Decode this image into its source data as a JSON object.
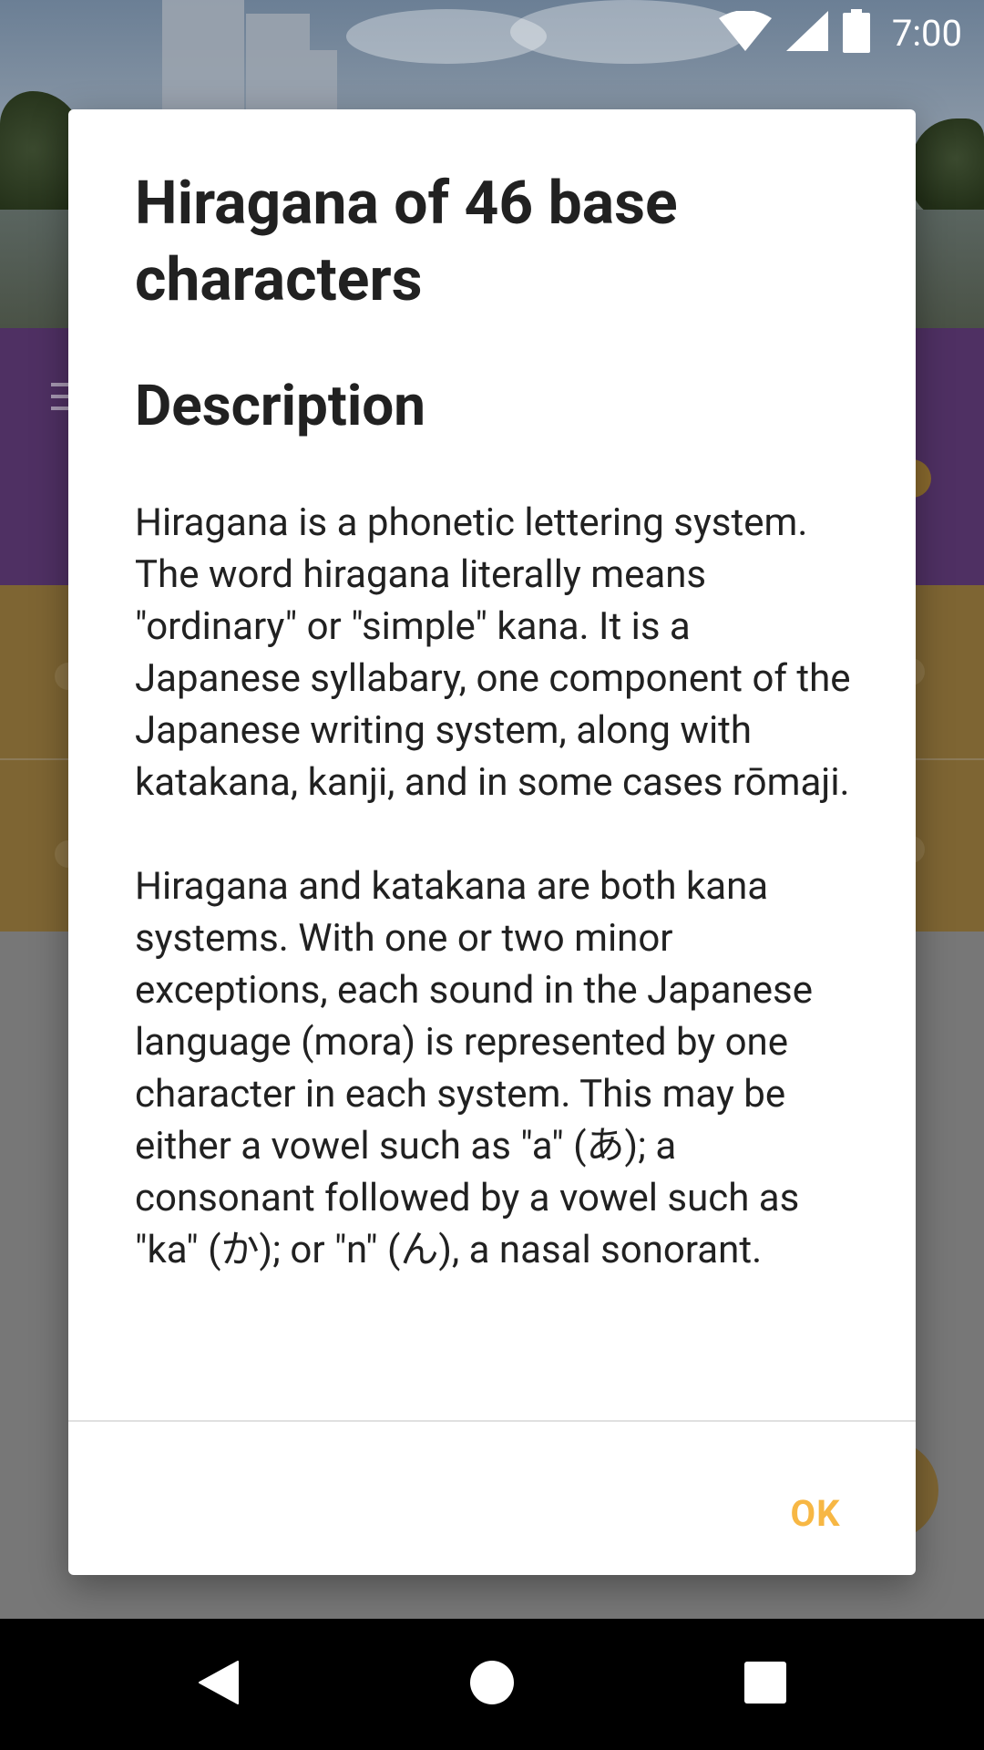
{
  "status_bar": {
    "time": "7:00",
    "icons": [
      "wifi-icon",
      "cell-signal-icon",
      "battery-icon"
    ]
  },
  "dialog": {
    "title": "Hiragana of 46 base characters",
    "heading": "Description",
    "paragraphs": [
      "Hiragana is a phonetic lettering system. The word hiragana literally means \"ordinary\" or \"simple\" kana. It is a Japanese syllabary, one component of the Japanese writing system, along with katakana, kanji, and in some cases rōmaji.",
      "Hiragana and katakana are both kana systems. With one or two minor exceptions, each sound in the Japanese language (mora) is represented by one character in each system. This may be either a vowel such as \"a\" (あ); a consonant followed by a vowel such as \"ka\" (か); or \"n\" (ん), a nasal sonorant."
    ],
    "ok_label": "OK"
  },
  "nav_bar": {
    "icons": [
      "back-icon",
      "home-icon",
      "recents-icon"
    ]
  },
  "colors": {
    "accent": "#f7b744",
    "app_primary": "#7d4c9e",
    "app_secondary": "#f0b342",
    "scrim": "rgba(0,0,0,0.5)"
  }
}
